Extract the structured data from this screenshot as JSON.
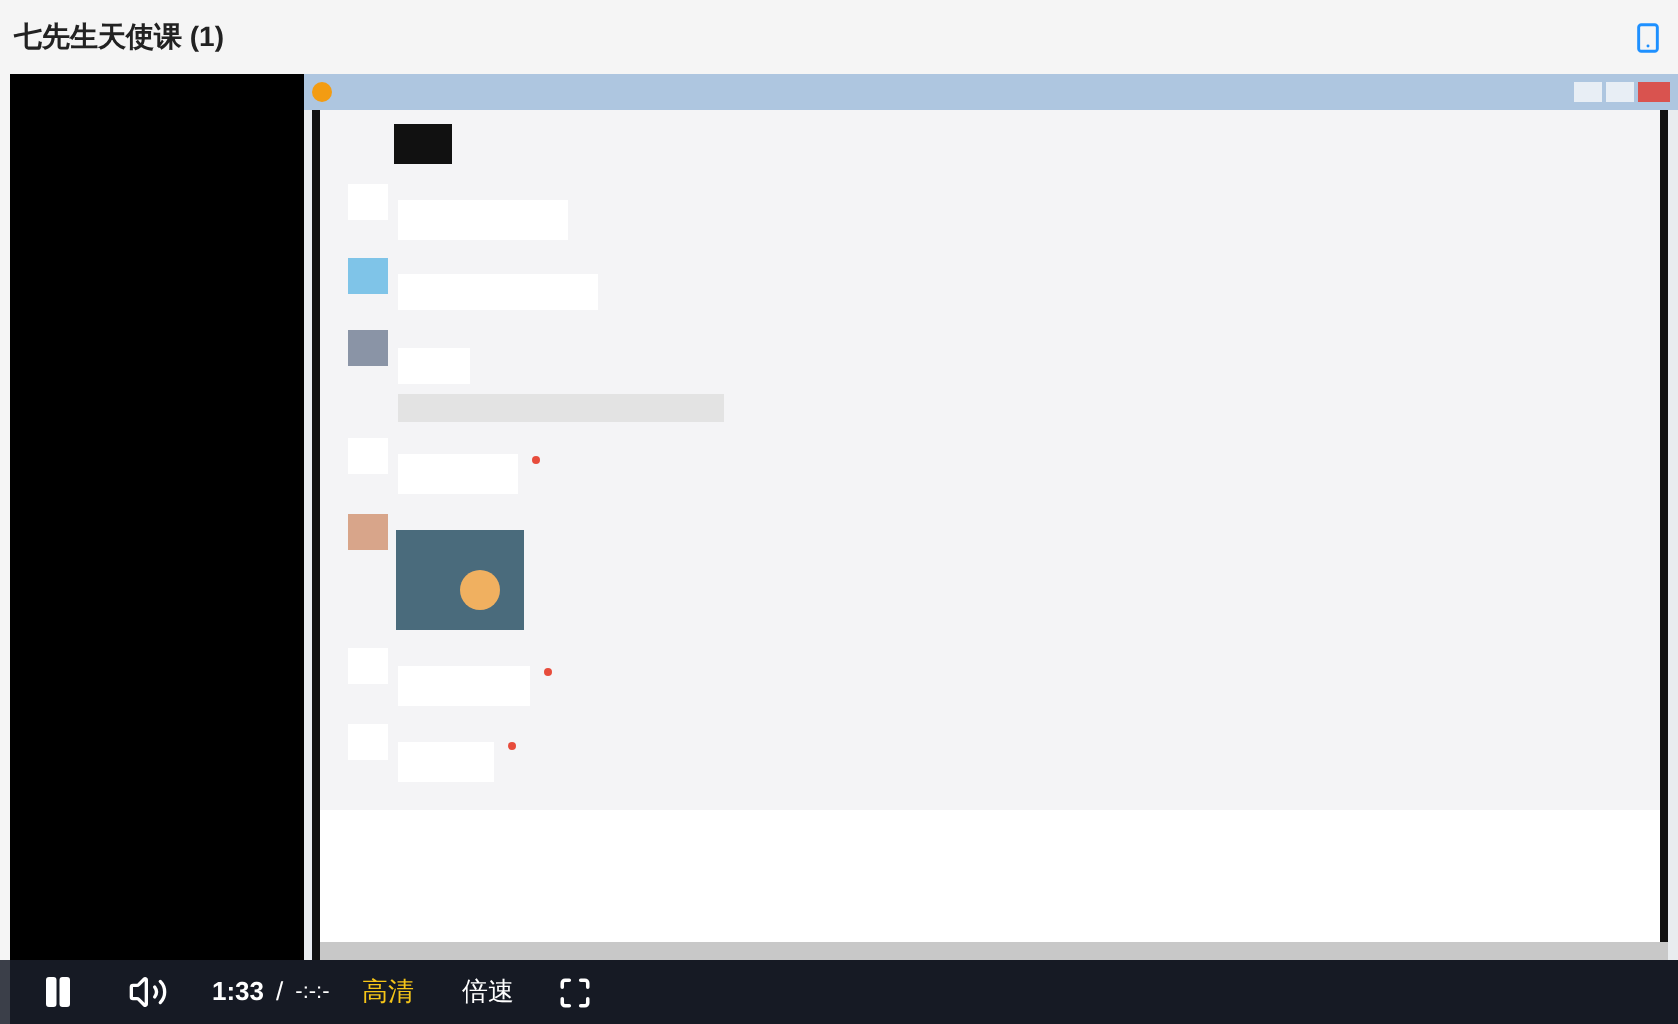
{
  "page": {
    "title": "七先生天使课 (1)"
  },
  "player": {
    "playing": true,
    "current_time": "1:33",
    "separator": "/",
    "duration": "-:-:-",
    "quality": "高清",
    "speed": "倍速"
  }
}
